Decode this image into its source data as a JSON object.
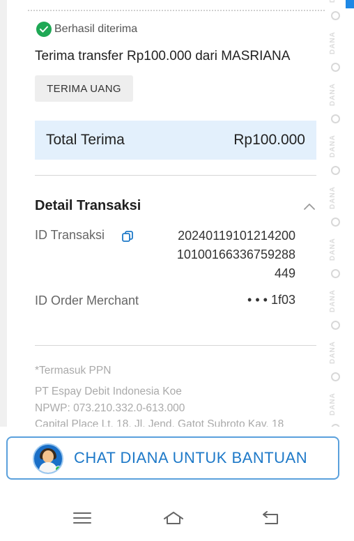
{
  "receipt": {
    "status": "Berhasil diterima",
    "title": "Terima transfer Rp100.000 dari MASRIANA",
    "chip_label": "TERIMA UANG",
    "total_label": "Total Terima",
    "total_value": "Rp100.000"
  },
  "details": {
    "section_title": "Detail Transaksi",
    "tx_id_label": "ID Transaksi",
    "tx_id_lines": [
      "20240119101214200",
      "10100166336759288",
      "449"
    ],
    "order_label": "ID Order Merchant",
    "order_value": "• • • 1f03"
  },
  "footer": {
    "ppn": "*Termasuk PPN",
    "company": "PT Espay Debit Indonesia Koe",
    "npwp": "NPWP: 073.210.332.0-613.000",
    "address": "Capital Place Lt. 18, Jl. Jend. Gatot Subroto Kav. 18"
  },
  "watermark_word": "DANA",
  "chat_button": {
    "label": "CHAT DIANA UNTUK BANTUAN"
  },
  "nav": {
    "items": [
      "menu-icon",
      "home-icon",
      "back-icon"
    ]
  },
  "colors": {
    "success": "#1fa855",
    "accent_blue": "#1e79c8",
    "total_bg": "#e3f0fc"
  }
}
